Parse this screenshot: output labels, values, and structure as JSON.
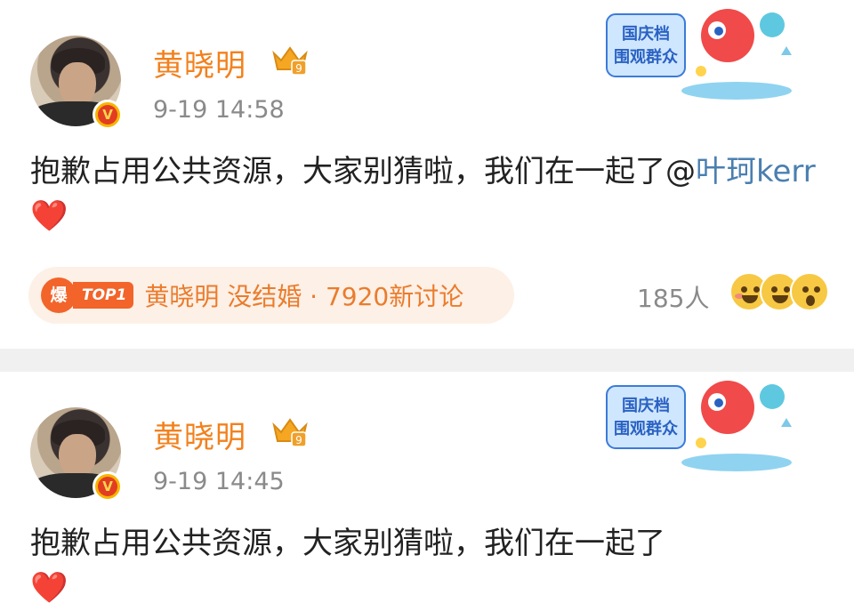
{
  "posts": [
    {
      "username": "黄晓明",
      "timestamp": "9-19 14:58",
      "event_badge": {
        "line1": "国庆档",
        "line2": "围观群众"
      },
      "content_text": "抱歉占用公共资源，大家别猜啦，我们在一起了@",
      "mention": "叶珂kerr",
      "heart": "❤️",
      "hot_topic": {
        "badge": "爆",
        "rank": "TOP1",
        "text": "黄晓明 没结婚 · 7920新讨论"
      },
      "reaction_count": "185人"
    },
    {
      "username": "黄晓明",
      "timestamp": "9-19 14:45",
      "event_badge": {
        "line1": "国庆档",
        "line2": "围观群众"
      },
      "content_text": "抱歉占用公共资源，大家别猜啦，我们在一起了",
      "heart": "❤️"
    }
  ],
  "icons": {
    "verified": "verified-v-icon",
    "crown": "crown-level-icon",
    "reactions": [
      "laugh-emoji-icon",
      "grin-emoji-icon",
      "surprised-emoji-icon"
    ]
  },
  "colors": {
    "username": "#f2811d",
    "mention": "#4a7fb0",
    "hot_topic_bg": "#fdf0e6",
    "hot_topic_accent": "#f2642a"
  }
}
